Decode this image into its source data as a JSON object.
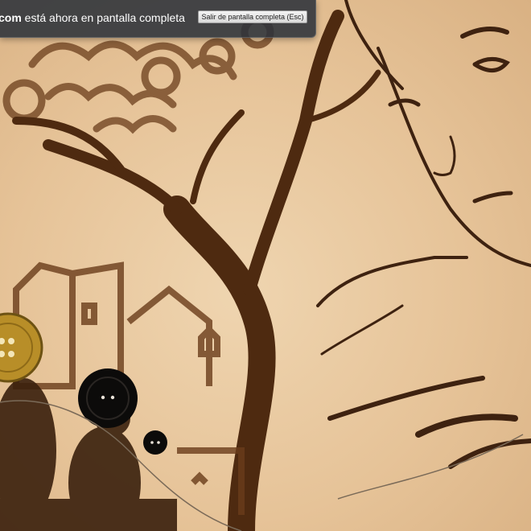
{
  "fullscreen_notice": {
    "domain": "com",
    "message": " está ahora en pantalla completa",
    "exit_button_label": "Salir de pantalla completa (Esc)"
  },
  "colors": {
    "sand_background": "#e8c9a0",
    "sand_ink": "#5a3315",
    "notice_background": "#2c323a"
  }
}
